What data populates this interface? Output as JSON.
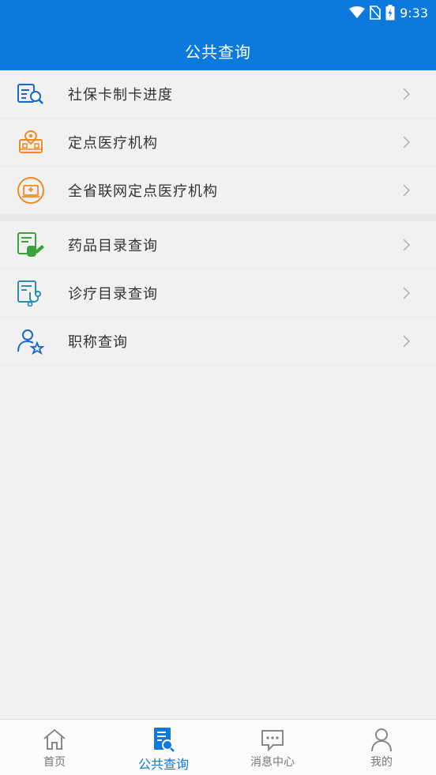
{
  "status": {
    "time": "9:33"
  },
  "header": {
    "title": "公共查询"
  },
  "groups": [
    {
      "items": [
        {
          "label": "社保卡制卡进度",
          "icon": "card-search-icon",
          "color": "#1769c7"
        },
        {
          "label": "定点医疗机构",
          "icon": "hospital-pin-icon",
          "color": "#f08a24"
        },
        {
          "label": "全省联网定点医疗机构",
          "icon": "network-hospital-icon",
          "color": "#f08a24"
        }
      ]
    },
    {
      "items": [
        {
          "label": "药品目录查询",
          "icon": "medicine-catalog-icon",
          "color": "#3aa23a"
        },
        {
          "label": "诊疗目录查询",
          "icon": "treatment-catalog-icon",
          "color": "#2b8fb0"
        },
        {
          "label": "职称查询",
          "icon": "title-user-icon",
          "color": "#1769c7"
        }
      ]
    }
  ],
  "tabbar": {
    "tabs": [
      {
        "label": "首页",
        "icon": "home-icon",
        "active": false
      },
      {
        "label": "公共查询",
        "icon": "query-document-icon",
        "active": true
      },
      {
        "label": "消息中心",
        "icon": "message-icon",
        "active": false
      },
      {
        "label": "我的",
        "icon": "user-icon",
        "active": false
      }
    ],
    "active_color": "#0d79dc"
  }
}
